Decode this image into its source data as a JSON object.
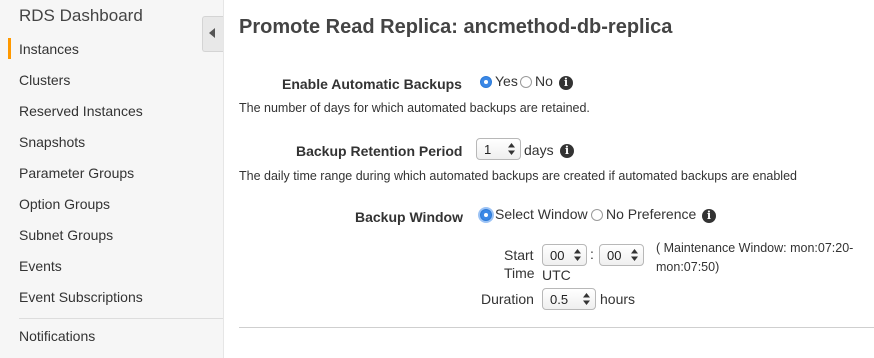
{
  "sidebar": {
    "title": "RDS Dashboard",
    "items": [
      {
        "label": "Instances"
      },
      {
        "label": "Clusters"
      },
      {
        "label": "Reserved Instances"
      },
      {
        "label": "Snapshots"
      },
      {
        "label": "Parameter Groups"
      },
      {
        "label": "Option Groups"
      },
      {
        "label": "Subnet Groups"
      },
      {
        "label": "Events"
      },
      {
        "label": "Event Subscriptions"
      },
      {
        "label": "Notifications"
      }
    ],
    "active_index": 0,
    "accent_color": "#ff9900"
  },
  "page": {
    "title": "Promote Read Replica: ancmethod-db-replica"
  },
  "backups": {
    "label": "Enable Automatic Backups",
    "yes_label": "Yes",
    "no_label": "No",
    "selected": "Yes",
    "help": "The number of days for which automated backups are retained."
  },
  "retention": {
    "label": "Backup Retention Period",
    "value": "1",
    "unit": "days",
    "help": "The daily time range during which automated backups are created if automated backups are enabled"
  },
  "window": {
    "label": "Backup Window",
    "select_label": "Select Window",
    "no_pref_label": "No Preference",
    "selected": "Select Window",
    "start_label_1": "Start",
    "start_label_2": "Time",
    "hour": "00",
    "minute": "00",
    "colon": ":",
    "tz": "UTC",
    "maintenance_1": "( Maintenance Window: mon:07:20-",
    "maintenance_2": "mon:07:50)",
    "duration_label": "Duration",
    "duration": "0.5",
    "duration_unit": "hours"
  },
  "icons": {
    "info": "info-icon",
    "collapse": "chevron-left-icon",
    "select_arrows": "updown-arrows-icon"
  },
  "colors": {
    "radio_selected": "#3b88e6"
  }
}
